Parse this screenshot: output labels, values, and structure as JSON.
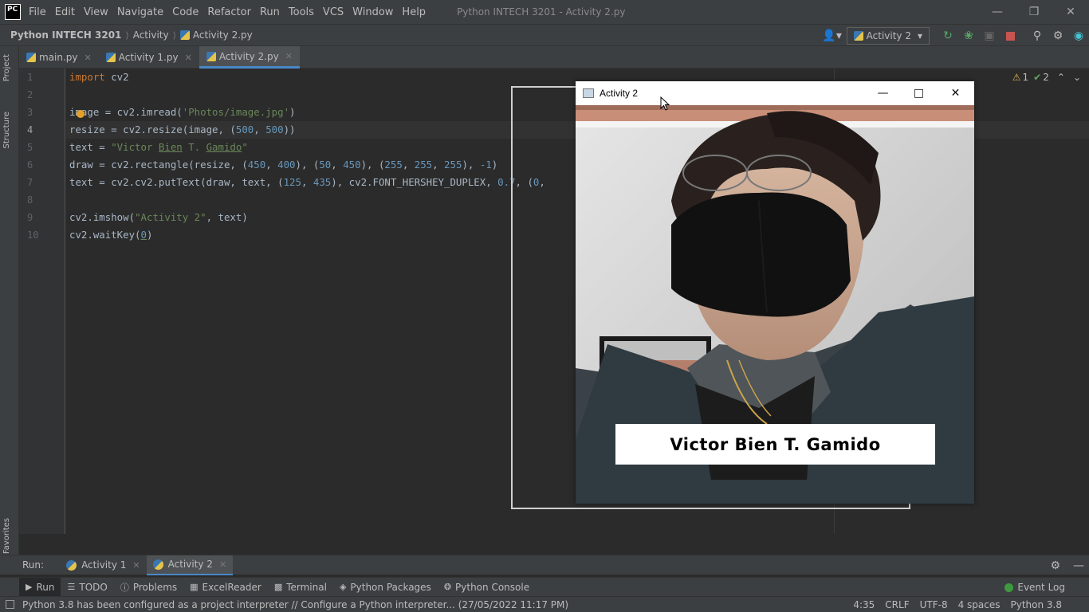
{
  "app": {
    "logo": "PC",
    "window_title": "Python INTECH 3201 - Activity 2.py",
    "menu": [
      "File",
      "Edit",
      "View",
      "Navigate",
      "Code",
      "Refactor",
      "Run",
      "Tools",
      "VCS",
      "Window",
      "Help"
    ]
  },
  "navbar": {
    "project": "Python INTECH 3201",
    "folder": "Activity",
    "file": "Activity 2.py",
    "run_config": "Activity 2"
  },
  "left_strip": {
    "project": "Project",
    "structure": "Structure",
    "favorites": "Favorites"
  },
  "editor_tabs": [
    {
      "label": "main.py"
    },
    {
      "label": "Activity 1.py"
    },
    {
      "label": "Activity 2.py"
    }
  ],
  "inspections": {
    "warnings": "1",
    "ok": "2"
  },
  "code": {
    "line_numbers": [
      "1",
      "2",
      "3",
      "4",
      "5",
      "6",
      "7",
      "8",
      "9",
      "10"
    ],
    "l1_kw": "import",
    "l1_rest": " cv2",
    "l3_a": "image = cv2.imread(",
    "l3_str": "'Photos/image.jpg'",
    "l3_b": ")",
    "l4_a": "resize = cv2.resize(image, (",
    "l4_n1": "500",
    "l4_b": ", ",
    "l4_n2": "500",
    "l4_c": "))",
    "l5_a": "text = ",
    "l5_s1": "\"Victor ",
    "l5_s2": "Bien",
    "l5_s3": " T. ",
    "l5_s4": "Gamido",
    "l5_s5": "\"",
    "l6_a": "draw = cv2.rectangle(resize, (",
    "l6_n1": "450",
    "l6_b": ", ",
    "l6_n2": "400",
    "l6_c": "), (",
    "l6_n3": "50",
    "l6_d": ", ",
    "l6_n4": "450",
    "l6_e": "), (",
    "l6_n5": "255",
    "l6_f": ", ",
    "l6_n6": "255",
    "l6_g": ", ",
    "l6_n7": "255",
    "l6_h": "), ",
    "l6_n8": "-1",
    "l6_i": ")",
    "l7_a": "text = cv2.cv2.putText(draw, text, (",
    "l7_n1": "125",
    "l7_b": ", ",
    "l7_n2": "435",
    "l7_c": "), cv2.FONT_HERSHEY_DUPLEX, ",
    "l7_n3": "0.7",
    "l7_d": ", (",
    "l7_n4": "0",
    "l7_e": ",",
    "l9_a": "cv2.imshow(",
    "l9_str": "\"Activity 2\"",
    "l9_b": ", text)",
    "l10_a": "cv2.waitKey(",
    "l10_n": "0",
    "l10_b": ")"
  },
  "cv_window": {
    "title": "Activity 2",
    "overlay_text": "Victor Bien T. Gamido"
  },
  "run_panel": {
    "label": "Run:",
    "tabs": [
      {
        "label": "Activity 1"
      },
      {
        "label": "Activity 2"
      }
    ]
  },
  "tool_windows": [
    {
      "label": "Run",
      "icon": "play-icon"
    },
    {
      "label": "TODO",
      "icon": "list-icon"
    },
    {
      "label": "Problems",
      "icon": "info-icon"
    },
    {
      "label": "ExcelReader",
      "icon": "table-icon"
    },
    {
      "label": "Terminal",
      "icon": "terminal-icon"
    },
    {
      "label": "Python Packages",
      "icon": "layers-icon"
    },
    {
      "label": "Python Console",
      "icon": "python-icon"
    }
  ],
  "event_log": "Event Log",
  "status": {
    "message": "Python 3.8 has been configured as a project interpreter // Configure a Python interpreter... (27/05/2022 11:17 PM)",
    "position": "4:35",
    "line_sep": "CRLF",
    "encoding": "UTF-8",
    "indent": "4 spaces",
    "interpreter": "Python 3.8"
  }
}
